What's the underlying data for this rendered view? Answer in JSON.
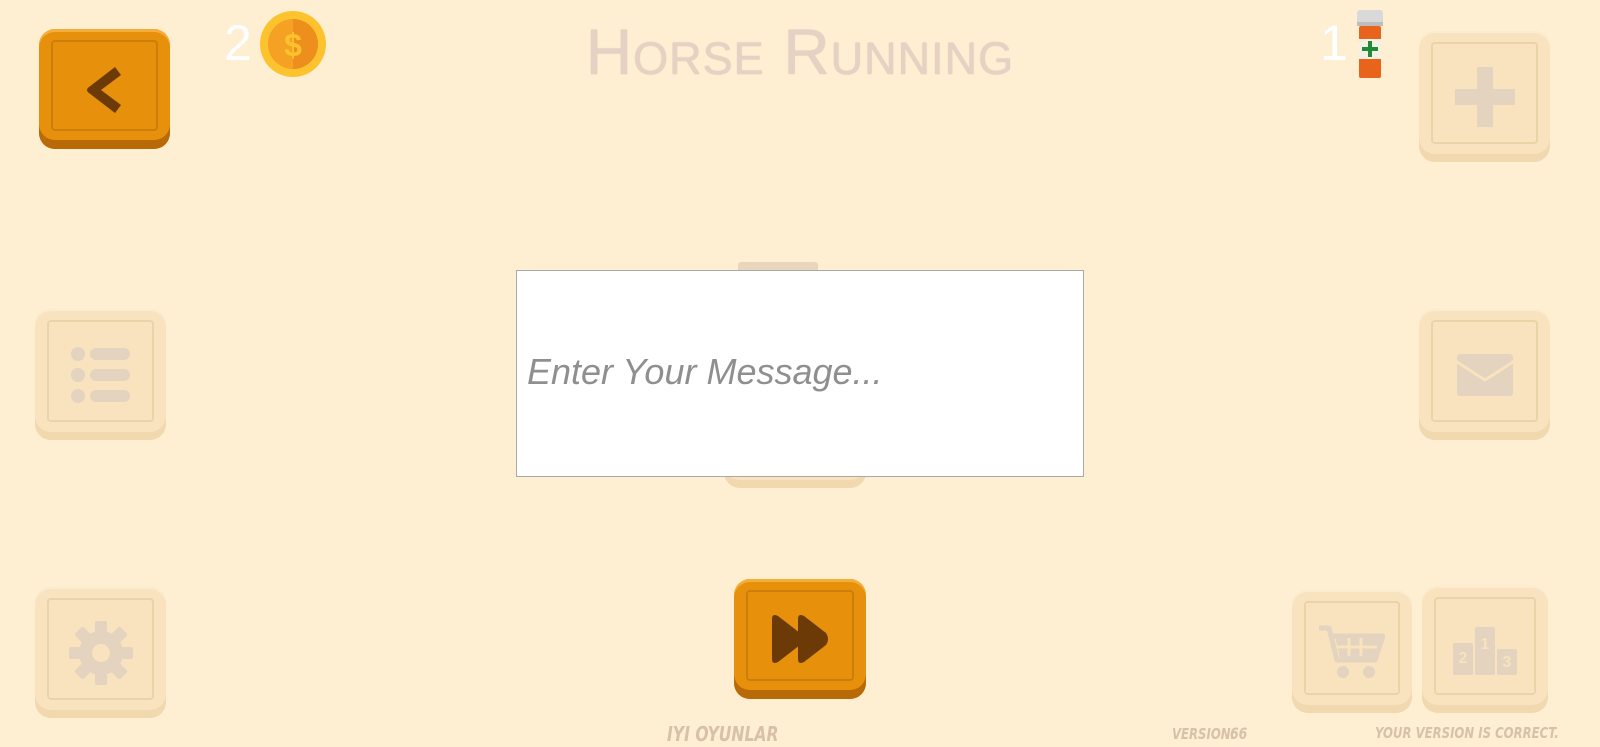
{
  "header": {
    "title": "Horse Running",
    "coins": "2",
    "coin_icon_symbol": "$",
    "potions": "1"
  },
  "message_box": {
    "placeholder": "Enter Your Message..."
  },
  "footer": {
    "developer": "IYI OYUNLAR",
    "version_label": "VERSION:",
    "version_number": "66",
    "version_status": "YOUR VERSION IS CORRECT."
  },
  "buttons": {
    "back": "chevron-left-icon",
    "add": "plus-icon",
    "list": "list-icon",
    "mail": "envelope-icon",
    "settings": "gear-icon",
    "play": "fast-forward-icon",
    "shop": "cart-icon",
    "leaderboard": "podium-icon"
  },
  "colors": {
    "background": "#FEEED2",
    "button_active": "#E7900C",
    "icon_dark": "#6B3A07",
    "button_faded": "#F8E3BE",
    "icon_faded": "#E3D3BF",
    "title": "#E6D1C5",
    "placeholder": "#8F8F8F"
  }
}
